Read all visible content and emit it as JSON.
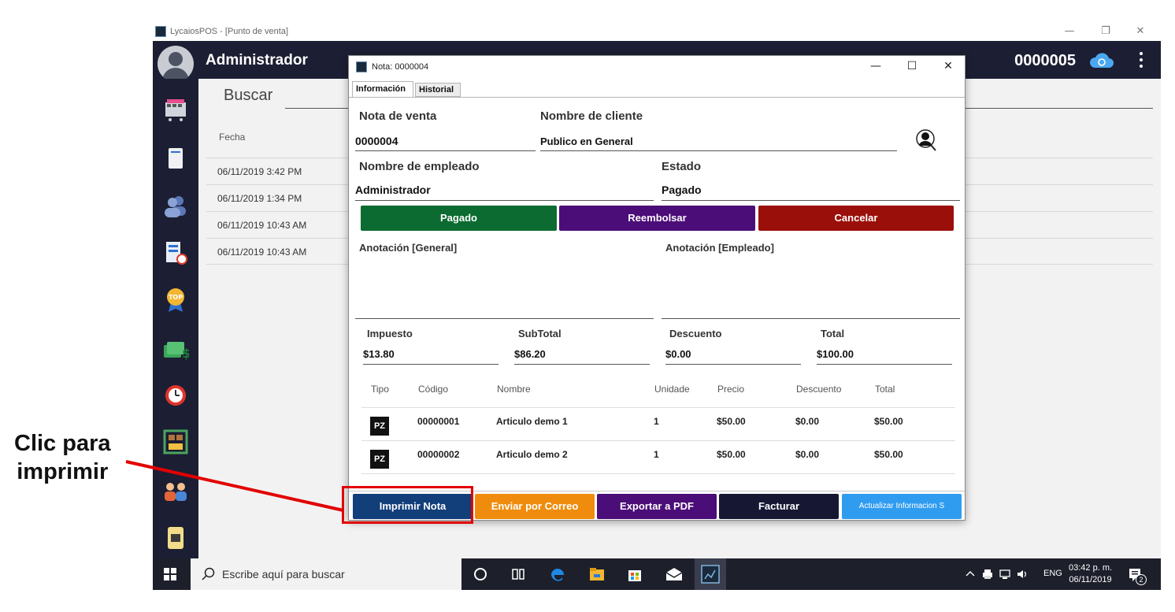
{
  "window": {
    "title": "LycaiosPOS - [Punto de venta]",
    "minimize": "—",
    "restore": "❐",
    "close": "✕"
  },
  "header": {
    "user": "Administrador",
    "note_number": "0000005"
  },
  "main": {
    "search_label": "Buscar",
    "column_date": "Fecha",
    "rows": [
      "06/11/2019 3:42 PM",
      "06/11/2019 1:34 PM",
      "06/11/2019 10:43 AM",
      "06/11/2019 10:43 AM"
    ]
  },
  "dialog": {
    "title": "Nota: 0000004",
    "minimize": "—",
    "maximize": "☐",
    "close": "✕",
    "tabs": [
      "Información",
      "Historial"
    ],
    "fields": {
      "nota_label": "Nota de venta",
      "nota_value": "0000004",
      "cliente_label": "Nombre de cliente",
      "cliente_value": "Publico en General",
      "empleado_label": "Nombre de empleado",
      "empleado_value": "Administrador",
      "estado_label": "Estado",
      "estado_value": "Pagado"
    },
    "status_buttons": {
      "pagado": "Pagado",
      "reembolsar": "Reembolsar",
      "cancelar": "Cancelar"
    },
    "annotations": {
      "general": "Anotación [General]",
      "empleado": "Anotación [Empleado]"
    },
    "totals": {
      "impuesto_label": "Impuesto",
      "impuesto_value": "$13.80",
      "subtotal_label": "SubTotal",
      "subtotal_value": "$86.20",
      "descuento_label": "Descuento",
      "descuento_value": "$0.00",
      "total_label": "Total",
      "total_value": "$100.00"
    },
    "items_table": {
      "headers": [
        "Tipo",
        "Código",
        "Nombre",
        "Unidade",
        "Precio",
        "Descuento",
        "Total"
      ],
      "rows": [
        {
          "tipo": "PZ",
          "codigo": "00000001",
          "nombre": "Articulo demo 1",
          "unidad": "1",
          "precio": "$50.00",
          "descuento": "$0.00",
          "total": "$50.00"
        },
        {
          "tipo": "PZ",
          "codigo": "00000002",
          "nombre": "Articulo demo 2",
          "unidad": "1",
          "precio": "$50.00",
          "descuento": "$0.00",
          "total": "$50.00"
        }
      ]
    },
    "actions": {
      "imprimir": "Imprimir Nota",
      "correo": "Enviar por Correo",
      "pdf": "Exportar a PDF",
      "facturar": "Facturar",
      "actualizar": "Actualizar Informacion S"
    }
  },
  "annotation_overlay": {
    "line1": "Clic para",
    "line2": "imprimir"
  },
  "taskbar": {
    "search_placeholder": "Escribe aquí para buscar",
    "language": "ENG",
    "time": "03:42 p. m.",
    "date": "06/11/2019",
    "notification_count": "2"
  },
  "colors": {
    "header_bg": "#1c1e33",
    "btn_pagado": "#0b6b30",
    "btn_reembolsar": "#4b0d78",
    "btn_cancelar": "#9b0f0b",
    "btn_imprimir": "#123e7a",
    "btn_correo": "#ef8c0d",
    "btn_pdf": "#4b0d78",
    "btn_facturar": "#161833",
    "btn_actualizar": "#2f9cf0",
    "annotation_red": "#e20000"
  }
}
